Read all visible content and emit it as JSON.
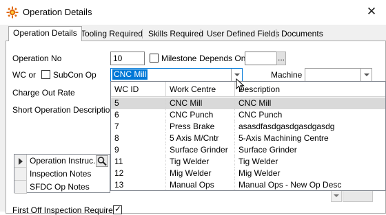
{
  "window": {
    "title": "Operation Details",
    "close_glyph": "✕",
    "icon": "gear-sun-icon"
  },
  "tabs": [
    {
      "label": "Operation Details",
      "active": true
    },
    {
      "label": "Tooling Required"
    },
    {
      "label": "Skills Required"
    },
    {
      "label": "User Defined Fields"
    },
    {
      "label": "Documents"
    }
  ],
  "form": {
    "operation_no_label": "Operation No",
    "operation_no_value": "10",
    "milestone_label": "Milestone",
    "milestone_checked": false,
    "depends_on_label": "Depends On",
    "depends_on_value": "",
    "browse_label": "...",
    "wc_or_label": "WC or",
    "subcon_label": "SubCon Op",
    "subcon_checked": false,
    "wc_value": "CNC Mill",
    "machine_label": "Machine",
    "machine_value": "",
    "charge_out_label": "Charge Out Rate",
    "short_desc_label": "Short Operation Description",
    "first_off_label": "First Off Inspection Required",
    "first_off_checked": true
  },
  "wc_dropdown": {
    "columns": [
      "WC ID",
      "Work Centre",
      "Description"
    ],
    "rows": [
      {
        "id": "5",
        "centre": "CNC Mill",
        "desc": "CNC Mill",
        "selected": true
      },
      {
        "id": "6",
        "centre": "CNC Punch",
        "desc": "CNC Punch"
      },
      {
        "id": "7",
        "centre": "Press Brake",
        "desc": "asasdfasdgasdgasdgasdg"
      },
      {
        "id": "8",
        "centre": "5 Axis M/Cntr",
        "desc": "5-Axis Machining Centre"
      },
      {
        "id": "9",
        "centre": "Surface Grinder",
        "desc": "Surface Grinder"
      },
      {
        "id": "11",
        "centre": "Tig Welder",
        "desc": "Tig Welder"
      },
      {
        "id": "12",
        "centre": "Mig Welder",
        "desc": "Mig Welder"
      },
      {
        "id": "13",
        "centre": "Manual Ops",
        "desc": "Manual Ops - New Op Desc"
      }
    ]
  },
  "notes_list": {
    "items": [
      "Operation Instruc...",
      "Inspection Notes",
      "SFDC Op Notes"
    ]
  },
  "colors": {
    "accent": "#0078d7",
    "selected_row": "#d9d9d9"
  }
}
